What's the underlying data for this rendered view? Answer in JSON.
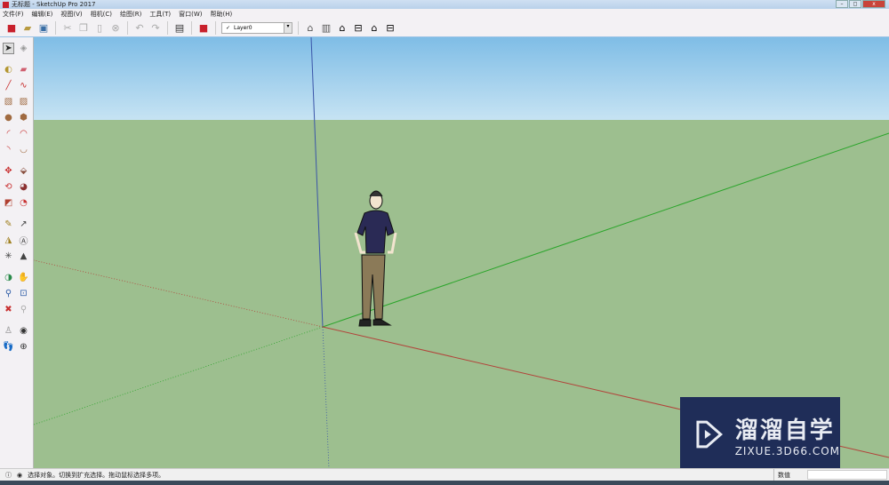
{
  "window": {
    "title": "无标题 - SketchUp Pro 2017",
    "controls": [
      "minimize",
      "restore",
      "close"
    ]
  },
  "menu": [
    "文件(F)",
    "编辑(E)",
    "视图(V)",
    "相机(C)",
    "绘图(R)",
    "工具(T)",
    "窗口(W)",
    "帮助(H)"
  ],
  "toolbar": {
    "icons": [
      "new-icon",
      "open-icon",
      "save-icon",
      "cut-icon",
      "copy-icon",
      "paste-icon",
      "erase-icon",
      "undo-icon",
      "redo-icon",
      "print-icon",
      "model-info-icon"
    ],
    "layer": {
      "check": "✓",
      "value": "Layer0"
    },
    "view_icons": [
      "iso-icon",
      "top-icon",
      "front-icon",
      "right-icon",
      "back-icon",
      "left-icon"
    ]
  },
  "left_tools": [
    "select",
    "make-component",
    "paint-bucket",
    "eraser",
    "line",
    "freehand",
    "rectangle",
    "rotated-rectangle",
    "circle",
    "polygon",
    "arc",
    "pie",
    "two-point-arc",
    "three-point-arc",
    "move",
    "push-pull",
    "rotate",
    "follow-me",
    "scale",
    "offset",
    "tape-measure",
    "dimension",
    "protractor",
    "text",
    "axes",
    "3d-text",
    "orbit",
    "pan",
    "zoom",
    "zoom-window",
    "zoom-extents",
    "previous",
    "position-camera",
    "look-around",
    "walk",
    "section-plane"
  ],
  "status": {
    "text": "选择对象。切换到扩充选择。拖动鼠标选择多项。",
    "measure_label": "数值"
  },
  "watermark": {
    "title": "溜溜自学",
    "url": "ZIXUE.3D66.COM"
  },
  "colors": {
    "sky": "#a8d4ee",
    "ground": "#9dbf8f",
    "x_axis": "#b2433a",
    "y_axis": "#2aa52a",
    "z_axis": "#3a55a8"
  }
}
